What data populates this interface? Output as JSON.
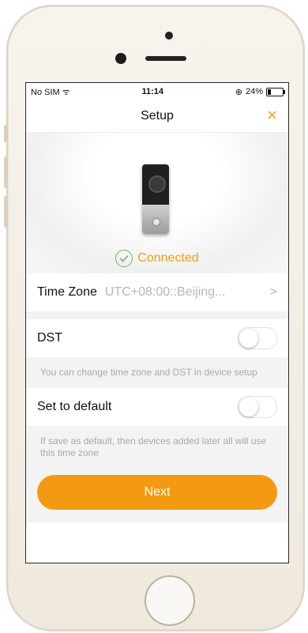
{
  "status_bar": {
    "carrier": "No SIM",
    "time": "11:14",
    "battery": "24%",
    "battery_level": 0.24
  },
  "header": {
    "title": "Setup",
    "close_icon": "×"
  },
  "device": {
    "connected_label": "Connected"
  },
  "time_zone": {
    "label": "Time Zone",
    "value": "UTC+08:00::Beijing...",
    "chevron": ">"
  },
  "dst": {
    "label": "DST",
    "enabled": false,
    "note": "You can change time zone and DST in device setup"
  },
  "default": {
    "label": "Set to default",
    "enabled": false,
    "note": "If save as default, then devices added later all will use this time zone"
  },
  "actions": {
    "next_label": "Next"
  },
  "colors": {
    "accent": "#f49a12",
    "success": "#6fb36f"
  }
}
